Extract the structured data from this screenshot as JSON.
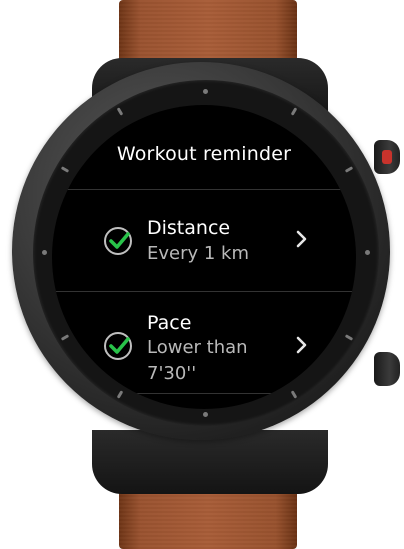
{
  "screen": {
    "title": "Workout reminder",
    "items": [
      {
        "label": "Distance",
        "value": "Every 1 km",
        "checked": true
      },
      {
        "label": "Pace",
        "value": "Lower than",
        "value_line2": "7'30''",
        "checked": true
      }
    ]
  },
  "icons": {
    "check": "check-circle-icon",
    "chevron": "chevron-right-icon"
  },
  "colors": {
    "screen_bg": "#000000",
    "check": "#29c34a",
    "text_primary": "#ffffff",
    "text_secondary": "#b9b9b9",
    "crown_accent": "#c8332c",
    "strap": "#a85d38"
  }
}
